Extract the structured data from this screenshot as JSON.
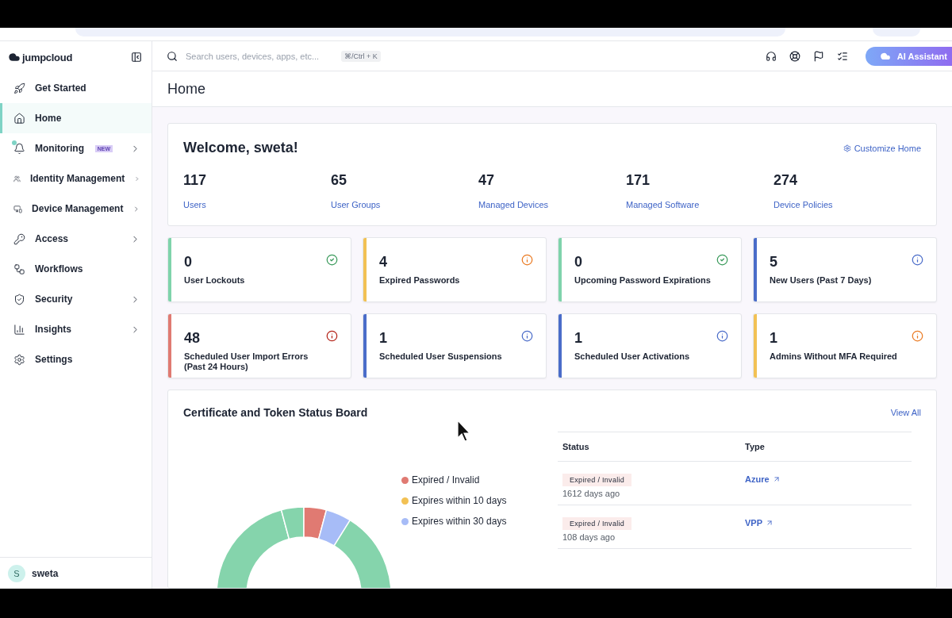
{
  "brand": "jumpcloud",
  "search": {
    "placeholder": "Search users, devices, apps, etc...",
    "shortcut": "⌘/Ctrl + K"
  },
  "assistant_button": "AI Assistant",
  "nav": [
    {
      "label": "Get Started",
      "selected": false,
      "has_children": false
    },
    {
      "label": "Home",
      "selected": true,
      "has_children": false
    },
    {
      "label": "Monitoring",
      "selected": false,
      "has_children": true,
      "badge": "NEW",
      "dot": true
    },
    {
      "label": "Identity Management",
      "selected": false,
      "has_children": true
    },
    {
      "label": "Device Management",
      "selected": false,
      "has_children": true
    },
    {
      "label": "Access",
      "selected": false,
      "has_children": true
    },
    {
      "label": "Workflows",
      "selected": false,
      "has_children": false
    },
    {
      "label": "Security",
      "selected": false,
      "has_children": true
    },
    {
      "label": "Insights",
      "selected": false,
      "has_children": true
    },
    {
      "label": "Settings",
      "selected": false,
      "has_children": false
    }
  ],
  "user": {
    "initial": "S",
    "name": "sweta"
  },
  "page_title": "Home",
  "welcome": {
    "title": "Welcome, sweta!",
    "customize": "Customize Home",
    "stats": [
      {
        "value": "117",
        "label": "Users"
      },
      {
        "value": "65",
        "label": "User Groups"
      },
      {
        "value": "47",
        "label": "Managed Devices"
      },
      {
        "value": "171",
        "label": "Managed Software"
      },
      {
        "value": "274",
        "label": "Device Policies"
      }
    ]
  },
  "status_cards": [
    {
      "value": "0",
      "label": "User Lockouts",
      "color": "#7fd3ab",
      "kind": "check"
    },
    {
      "value": "4",
      "label": "Expired Passwords",
      "color": "#f2c154",
      "kind": "info"
    },
    {
      "value": "0",
      "label": "Upcoming Password Expirations",
      "color": "#7fd3ab",
      "kind": "check"
    },
    {
      "value": "5",
      "label": "New Users (Past 7 Days)",
      "color": "#4a6cc9",
      "kind": "info"
    },
    {
      "value": "48",
      "label": "Scheduled User Import Errors (Past 24 Hours)",
      "color": "#e07a72",
      "kind": "error"
    },
    {
      "value": "1",
      "label": "Scheduled User Suspensions",
      "color": "#4a6cc9",
      "kind": "info"
    },
    {
      "value": "1",
      "label": "Scheduled User Activations",
      "color": "#4a6cc9",
      "kind": "info"
    },
    {
      "value": "1",
      "label": "Admins Without MFA Required",
      "color": "#f2c154",
      "kind": "info"
    }
  ],
  "cert_board": {
    "title": "Certificate and Token Status Board",
    "view_all": "View All",
    "legend": [
      {
        "label": "Expired / Invalid",
        "color": "#e07a72"
      },
      {
        "label": "Expires within 10 days",
        "color": "#f2c154"
      },
      {
        "label": "Expires within 30 days",
        "color": "#a7bcf7"
      }
    ],
    "columns": [
      "Status",
      "Type"
    ],
    "rows": [
      {
        "status": "Expired / Invalid",
        "age": "1612 days ago",
        "type": "Azure"
      },
      {
        "status": "Expired / Invalid",
        "age": "108 days ago",
        "type": "VPP"
      }
    ]
  }
}
